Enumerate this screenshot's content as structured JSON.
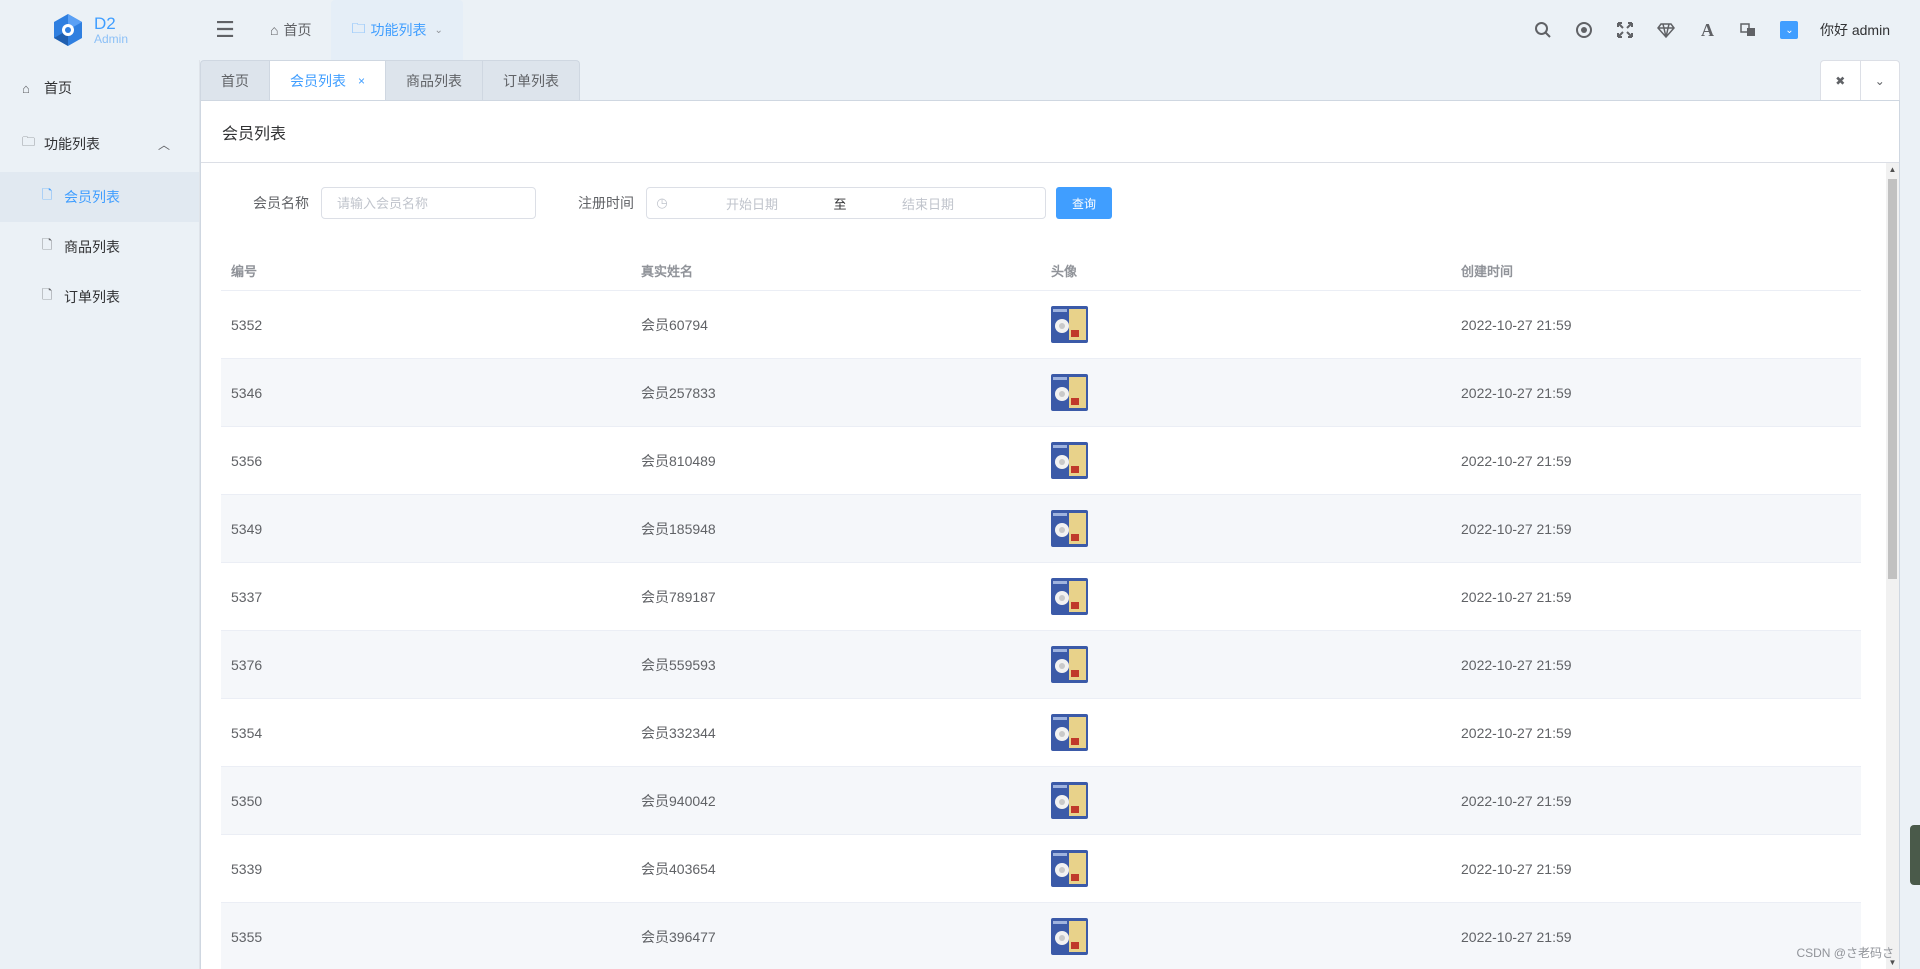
{
  "logo": {
    "title": "D2",
    "subtitle": "Admin"
  },
  "header": {
    "menu": [
      {
        "label": "首页",
        "icon": "home-icon"
      },
      {
        "label": "功能列表",
        "icon": "folder-icon"
      }
    ],
    "user": "你好 admin",
    "accent": "#409EFF"
  },
  "sidebar": {
    "items": [
      {
        "label": "首页",
        "icon": "home-icon"
      },
      {
        "label": "功能列表",
        "icon": "folder-icon"
      },
      {
        "label": "会员列表",
        "icon": "file-icon"
      },
      {
        "label": "商品列表",
        "icon": "file-icon"
      },
      {
        "label": "订单列表",
        "icon": "file-icon"
      }
    ]
  },
  "tabs": [
    {
      "label": "首页"
    },
    {
      "label": "会员列表",
      "close": "×"
    },
    {
      "label": "商品列表"
    },
    {
      "label": "订单列表"
    }
  ],
  "page": {
    "title": "会员列表"
  },
  "filter": {
    "name_label": "会员名称",
    "name_placeholder": "请输入会员名称",
    "date_label": "注册时间",
    "start_placeholder": "开始日期",
    "separator": "至",
    "end_placeholder": "结束日期",
    "query_button": "查询"
  },
  "table": {
    "columns": [
      "编号",
      "真实姓名",
      "头像",
      "创建时间"
    ],
    "rows": [
      {
        "id": "5352",
        "name": "会员60794",
        "created": "2022-10-27 21:59"
      },
      {
        "id": "5346",
        "name": "会员257833",
        "created": "2022-10-27 21:59"
      },
      {
        "id": "5356",
        "name": "会员810489",
        "created": "2022-10-27 21:59"
      },
      {
        "id": "5349",
        "name": "会员185948",
        "created": "2022-10-27 21:59"
      },
      {
        "id": "5337",
        "name": "会员789187",
        "created": "2022-10-27 21:59"
      },
      {
        "id": "5376",
        "name": "会员559593",
        "created": "2022-10-27 21:59"
      },
      {
        "id": "5354",
        "name": "会员332344",
        "created": "2022-10-27 21:59"
      },
      {
        "id": "5350",
        "name": "会员940042",
        "created": "2022-10-27 21:59"
      },
      {
        "id": "5339",
        "name": "会员403654",
        "created": "2022-10-27 21:59"
      },
      {
        "id": "5355",
        "name": "会员396477",
        "created": "2022-10-27 21:59"
      }
    ]
  },
  "watermark": "CSDN @さ老码さ"
}
